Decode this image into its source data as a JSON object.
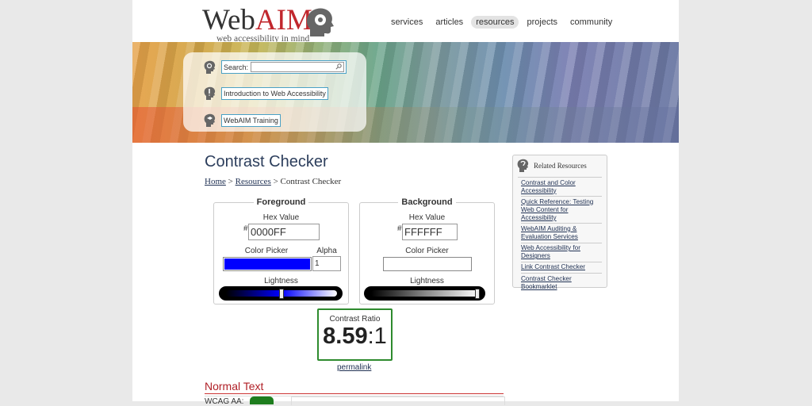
{
  "brand": {
    "name_a": "Web",
    "name_b": "AIM",
    "tagline": "web accessibility in mind"
  },
  "nav": [
    {
      "label": "services",
      "active": false
    },
    {
      "label": "articles",
      "active": false
    },
    {
      "label": "resources",
      "active": true
    },
    {
      "label": "projects",
      "active": false
    },
    {
      "label": "community",
      "active": false
    }
  ],
  "quicklinks": {
    "search_label": "Search:",
    "search_value": "",
    "intro_label": "Introduction to Web Accessibility",
    "training_label": "WebAIM Training"
  },
  "page": {
    "title": "Contrast Checker",
    "breadcrumb": {
      "home": "Home",
      "sep1": " > ",
      "resources": "Resources",
      "sep2": " > ",
      "current": "Contrast Checker"
    }
  },
  "foreground": {
    "legend": "Foreground",
    "hex_label": "Hex Value",
    "hash": "#",
    "hex_value": "0000FF",
    "picker_label": "Color Picker",
    "alpha_label": "Alpha",
    "alpha_value": "1",
    "lightness_label": "Lightness",
    "lightness": 0.5,
    "color": "#0000FF"
  },
  "background": {
    "legend": "Background",
    "hex_label": "Hex Value",
    "hash": "#",
    "hex_value": "FFFFFF",
    "picker_label": "Color Picker",
    "lightness_label": "Lightness",
    "lightness": 1.0,
    "color": "#FFFFFF"
  },
  "result": {
    "label": "Contrast Ratio",
    "value": "8.59",
    "suffix": ":1",
    "permalink": "permalink"
  },
  "normal_text": {
    "heading": "Normal Text",
    "wcag_aa_label": "WCAG AA:"
  },
  "sidebar": {
    "title": "Related Resources",
    "links": [
      "Contrast and Color Accessibility",
      "Quick Reference: Testing Web Content for Accessibility",
      "WebAIM Auditing & Evaluation Services",
      "Web Accessibility for Designers",
      "Link Contrast Checker",
      "Contrast Checker Bookmarklet"
    ]
  },
  "colors": {
    "accent_red": "#c1272d",
    "pass_green": "#2e8b2e",
    "link": "#223355"
  }
}
